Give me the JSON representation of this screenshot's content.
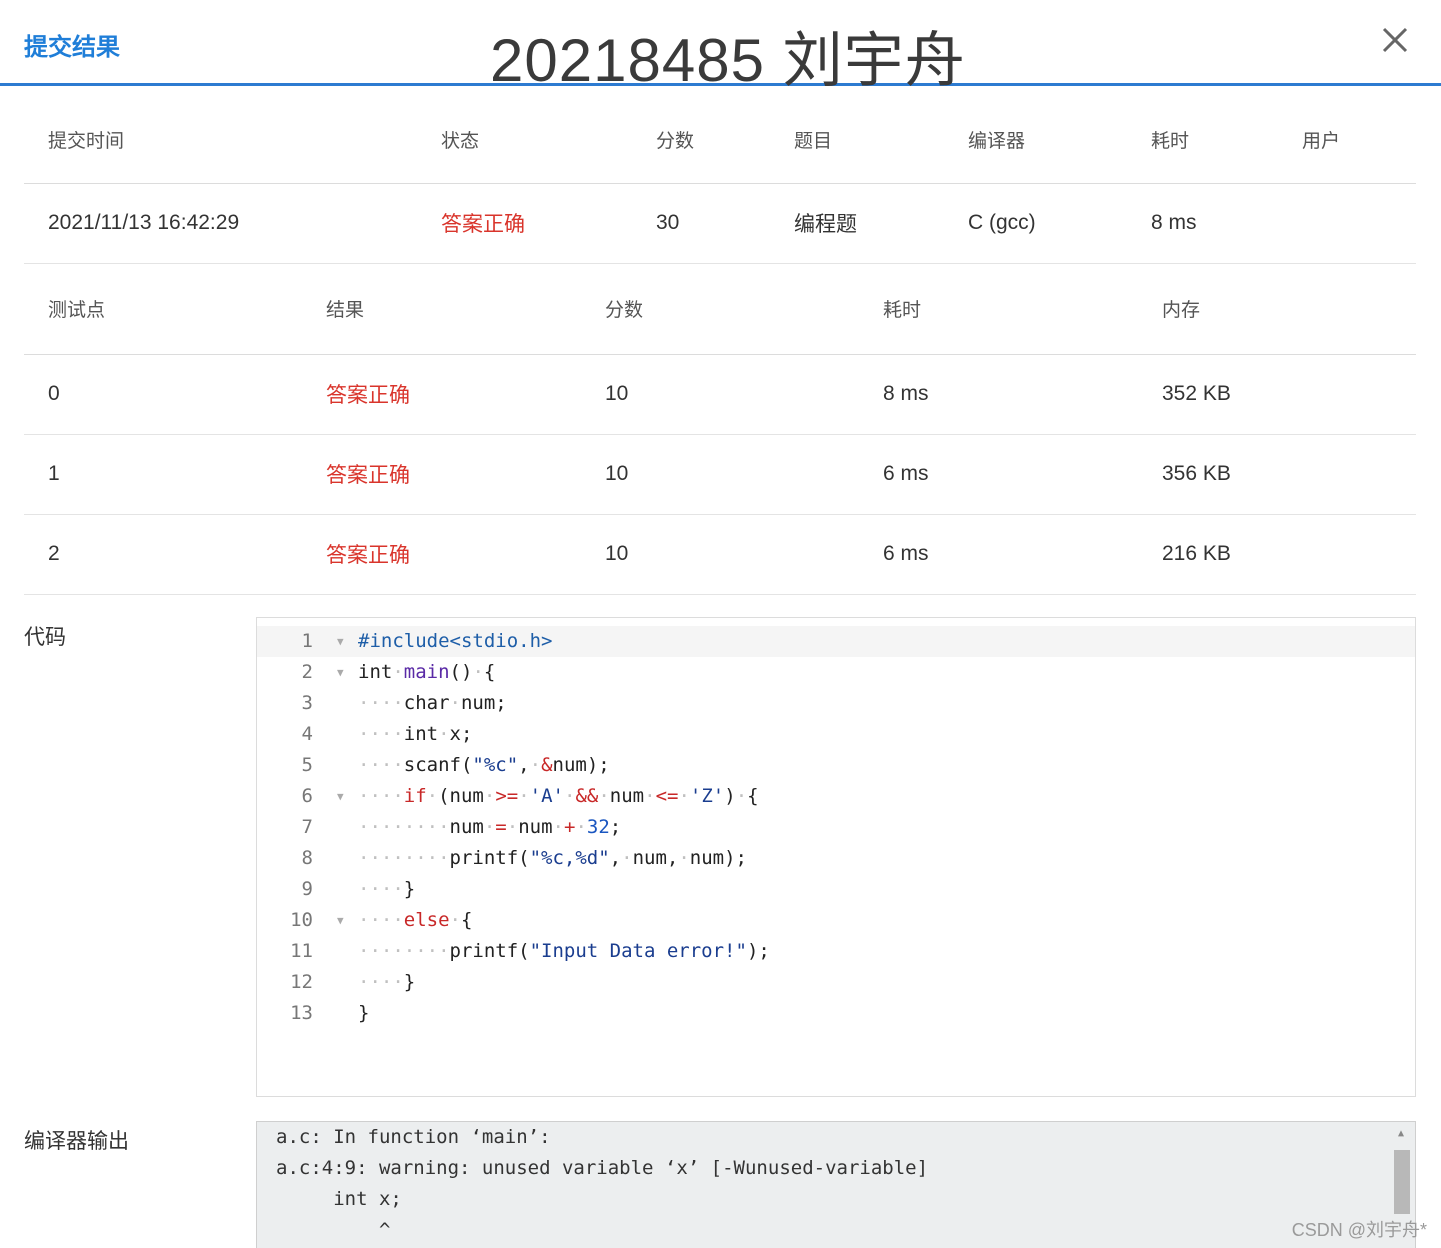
{
  "header": {
    "title": "提交结果",
    "overlay_name": "20218485 刘宇舟",
    "close_icon": "close-icon"
  },
  "summary": {
    "columns": [
      "提交时间",
      "状态",
      "分数",
      "题目",
      "编译器",
      "耗时",
      "用户"
    ],
    "row": {
      "time": "2021/11/13 16:42:29",
      "status": "答案正确",
      "score": "30",
      "problem": "编程题",
      "compiler": "C (gcc)",
      "elapsed": "8 ms",
      "user": ""
    }
  },
  "cases": {
    "columns": [
      "测试点",
      "结果",
      "分数",
      "耗时",
      "内存"
    ],
    "rows": [
      {
        "id": "0",
        "result": "答案正确",
        "score": "10",
        "time": "8 ms",
        "memory": "352 KB"
      },
      {
        "id": "1",
        "result": "答案正确",
        "score": "10",
        "time": "6 ms",
        "memory": "356 KB"
      },
      {
        "id": "2",
        "result": "答案正确",
        "score": "10",
        "time": "6 ms",
        "memory": "216 KB"
      }
    ]
  },
  "code_section": {
    "label": "代码",
    "lines": [
      "#include<stdio.h>",
      "int main() {",
      "    char num;",
      "    int x;",
      "    scanf(\"%c\", &num);",
      "    if (num >= 'A' && num <= 'Z') {",
      "        num = num + 32;",
      "        printf(\"%c,%d\", num, num);",
      "    }",
      "    else {",
      "        printf(\"Input Data error!\");",
      "    }",
      "}"
    ]
  },
  "output_section": {
    "label": "编译器输出",
    "lines": [
      "a.c: In function ‘main’:",
      "a.c:4:9: warning: unused variable ‘x’ [-Wunused-variable]",
      "     int x;",
      "         ^"
    ]
  },
  "watermark": "CSDN @刘宇舟*",
  "colors": {
    "accent": "#1f7ed8",
    "status_ok": "#d9342b"
  }
}
